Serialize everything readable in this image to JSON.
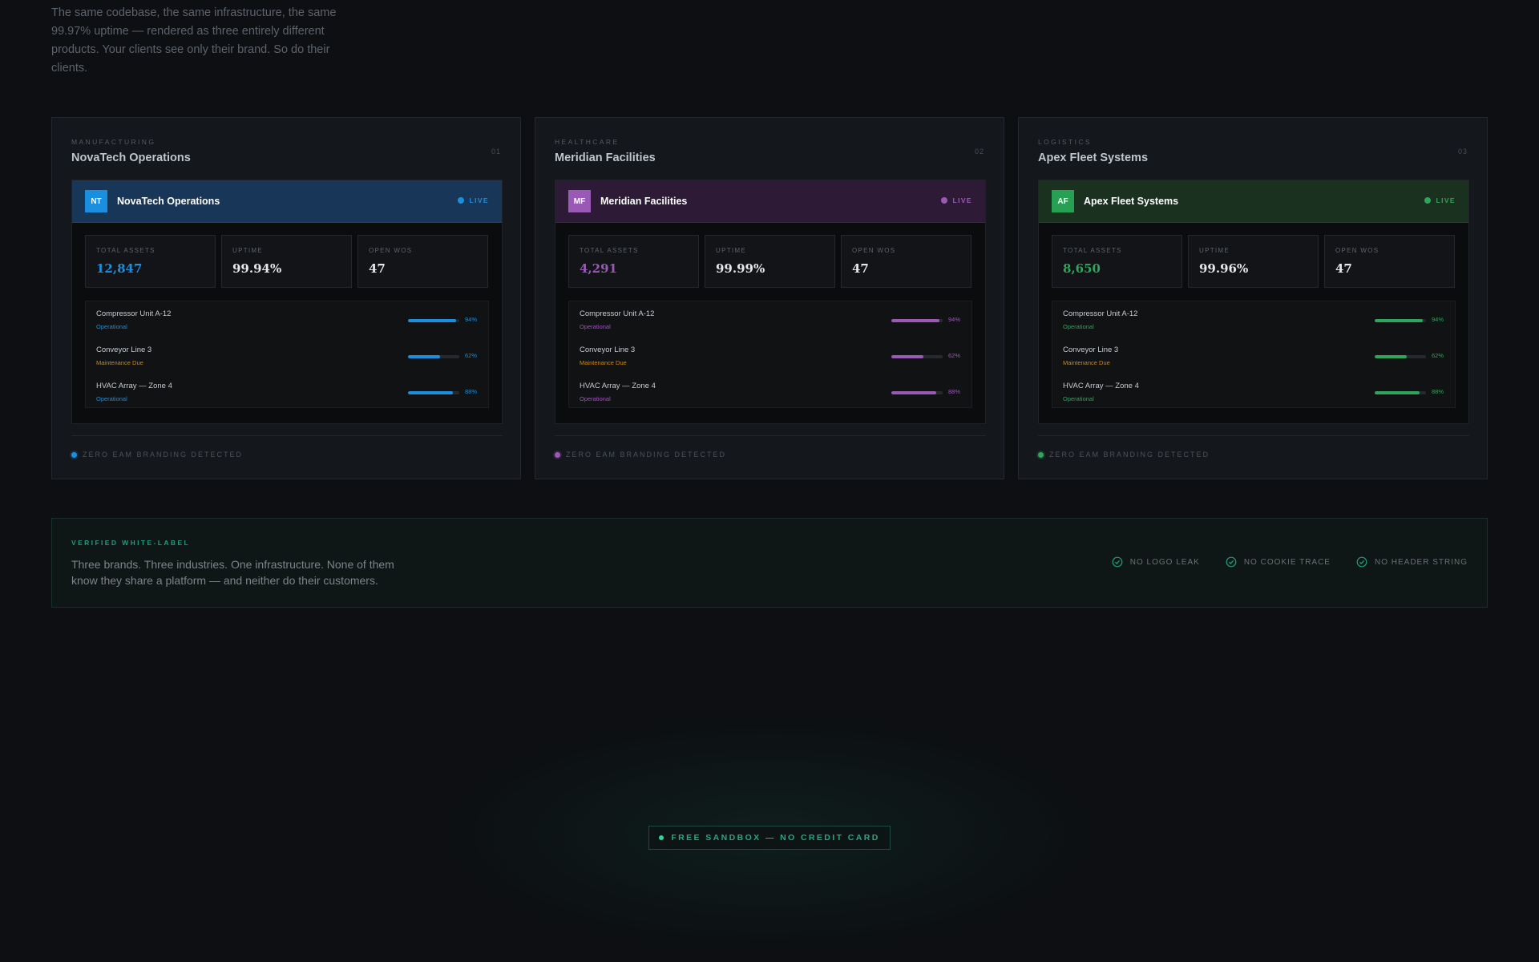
{
  "intro": {
    "text": "The same codebase, the same infrastructure, the same 99.97% uptime — rendered as three entirely different products. Your clients see only their brand. So do their clients."
  },
  "cards": [
    {
      "industry": "MANUFACTURING",
      "title": "NovaTech Operations",
      "number": "01",
      "accent": "#1a8fe0",
      "avatar_bg": "#1a8fe0",
      "initials": "NT",
      "app_name": "NovaTech Operations",
      "live_label": "LIVE",
      "stats": [
        {
          "label": "TOTAL ASSETS",
          "value": "12,847",
          "accented": true
        },
        {
          "label": "UPTIME",
          "value": "99.94%",
          "accented": false
        },
        {
          "label": "OPEN WOS",
          "value": "47",
          "accented": false
        }
      ],
      "assets": [
        {
          "name": "Compressor Unit A-12",
          "status": "Operational",
          "status_kind": "ok",
          "percent_label": "94%",
          "percent": 94
        },
        {
          "name": "Conveyor Line 3",
          "status": "Maintenance Due",
          "status_kind": "warn",
          "percent_label": "62%",
          "percent": 62
        },
        {
          "name": "HVAC Array — Zone 4",
          "status": "Operational",
          "status_kind": "ok",
          "percent_label": "88%",
          "percent": 88
        }
      ],
      "footer": "ZERO EAM BRANDING DETECTED"
    },
    {
      "industry": "HEALTHCARE",
      "title": "Meridian Facilities",
      "number": "02",
      "accent": "#9b59b6",
      "avatar_bg": "#9b59b6",
      "initials": "MF",
      "app_name": "Meridian Facilities",
      "live_label": "LIVE",
      "stats": [
        {
          "label": "TOTAL ASSETS",
          "value": "4,291",
          "accented": true
        },
        {
          "label": "UPTIME",
          "value": "99.99%",
          "accented": false
        },
        {
          "label": "OPEN WOS",
          "value": "47",
          "accented": false
        }
      ],
      "assets": [
        {
          "name": "Compressor Unit A-12",
          "status": "Operational",
          "status_kind": "ok",
          "percent_label": "94%",
          "percent": 94
        },
        {
          "name": "Conveyor Line 3",
          "status": "Maintenance Due",
          "status_kind": "warn",
          "percent_label": "62%",
          "percent": 62
        },
        {
          "name": "HVAC Array — Zone 4",
          "status": "Operational",
          "status_kind": "ok",
          "percent_label": "88%",
          "percent": 88
        }
      ],
      "footer": "ZERO EAM BRANDING DETECTED"
    },
    {
      "industry": "LOGISTICS",
      "title": "Apex Fleet Systems",
      "number": "03",
      "accent": "#2ea55a",
      "avatar_bg": "#27a054",
      "initials": "AF",
      "app_name": "Apex Fleet Systems",
      "live_label": "LIVE",
      "stats": [
        {
          "label": "TOTAL ASSETS",
          "value": "8,650",
          "accented": true
        },
        {
          "label": "UPTIME",
          "value": "99.96%",
          "accented": false
        },
        {
          "label": "OPEN WOS",
          "value": "47",
          "accented": false
        }
      ],
      "assets": [
        {
          "name": "Compressor Unit A-12",
          "status": "Operational",
          "status_kind": "ok",
          "percent_label": "94%",
          "percent": 94
        },
        {
          "name": "Conveyor Line 3",
          "status": "Maintenance Due",
          "status_kind": "warn",
          "percent_label": "62%",
          "percent": 62
        },
        {
          "name": "HVAC Array — Zone 4",
          "status": "Operational",
          "status_kind": "ok",
          "percent_label": "88%",
          "percent": 88
        }
      ],
      "footer": "ZERO EAM BRANDING DETECTED"
    }
  ],
  "colors": {
    "warn": "#c98a1e",
    "verified_accent": "#1f9c7c",
    "cta_accent": "#2bd4a4"
  },
  "verified": {
    "label": "VERIFIED WHITE-LABEL",
    "text": "Three brands. Three industries. One infrastructure. None of them know they share a platform — and neither do their customers.",
    "checks": [
      "NO LOGO LEAK",
      "NO COOKIE TRACE",
      "NO HEADER STRING"
    ],
    "check_icon": "check-circle-icon"
  },
  "cta": {
    "label": "FREE SANDBOX — NO CREDIT CARD"
  }
}
